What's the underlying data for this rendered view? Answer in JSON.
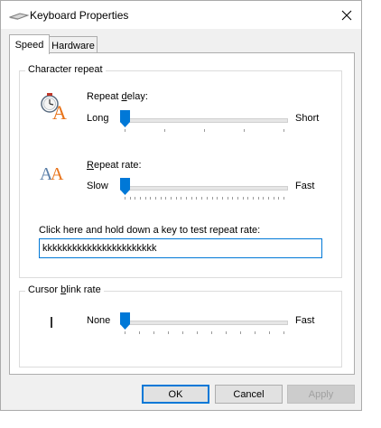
{
  "window": {
    "title": "Keyboard Properties"
  },
  "tabs": [
    {
      "label": "Speed",
      "active": true
    },
    {
      "label": "Hardware",
      "active": false
    }
  ],
  "character_repeat": {
    "group_label": "Character repeat",
    "repeat_delay": {
      "label": "Repeat delay:",
      "min_label": "Long",
      "max_label": "Short",
      "value_fraction": 0.0
    },
    "repeat_rate": {
      "label": "Repeat rate:",
      "min_label": "Slow",
      "max_label": "Fast",
      "value_fraction": 0.0
    },
    "test_label": "Click here and hold down a key to test repeat rate:",
    "test_value": "kkkkkkkkkkkkkkkkkkkkkkk"
  },
  "cursor_blink": {
    "group_label": "Cursor blink rate",
    "min_label": "None",
    "max_label": "Fast",
    "value_fraction": 0.0
  },
  "buttons": {
    "ok": "OK",
    "cancel": "Cancel",
    "apply": "Apply"
  },
  "colors": {
    "accent": "#0078d7",
    "icon_orange": "#e8731a",
    "icon_blue": "#5b7fa8"
  }
}
